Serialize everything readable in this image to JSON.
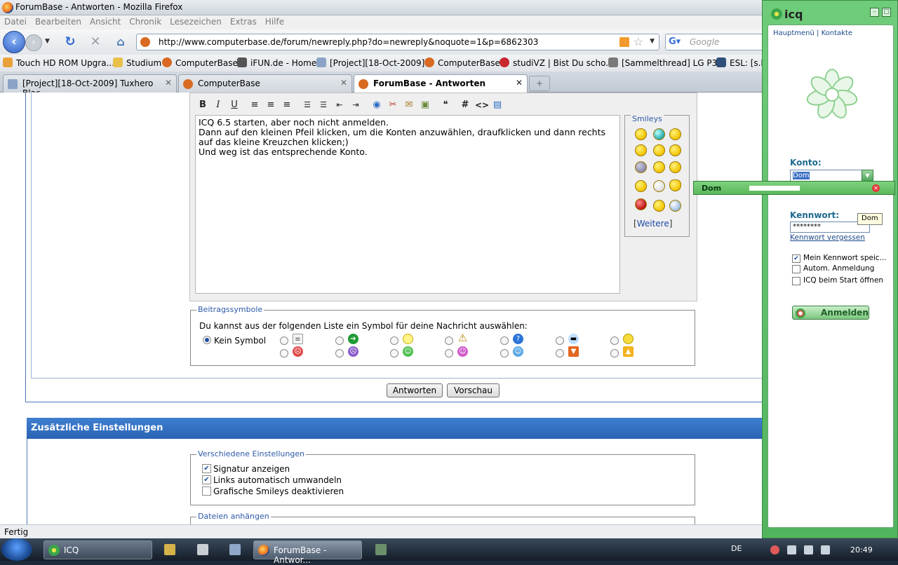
{
  "firefox": {
    "window_title": "ForumBase - Antworten - Mozilla Firefox",
    "menu": [
      "Datei",
      "Bearbeiten",
      "Ansicht",
      "Chronik",
      "Lesezeichen",
      "Extras",
      "Hilfe"
    ],
    "url": "http://www.computerbase.de/forum/newreply.php?do=newreply&noquote=1&p=6862303",
    "search_placeholder": "Google",
    "bookmarks": [
      "Touch HD ROM Upgra...",
      "Studium",
      "ComputerBase",
      "iFUN.de - Home",
      "[Project][18-Oct-2009]...",
      "ComputerBase",
      "studiVZ | Bist Du scho...",
      "[Sammelthread] LG P3...",
      "ESL: [s.k"
    ],
    "tabs": [
      {
        "label": "[Project][18-Oct-2009] Tuxhero Blac...",
        "active": false
      },
      {
        "label": "ComputerBase",
        "active": false
      },
      {
        "label": "ForumBase - Antworten",
        "active": true
      }
    ],
    "status": "Fertig"
  },
  "editor": {
    "lines": [
      "ICQ 6.5 starten, aber noch nicht anmelden.",
      "Dann auf den kleinen Pfeil klicken, um die Konten anzuwählen, draufklicken und dann rechts",
      "auf das kleine Kreuzchen klicken;)",
      "Und weg ist das entsprechende Konto."
    ],
    "toolbar": {
      "bold": "B",
      "italic": "I",
      "underline": "U",
      "code": "#",
      "html": "<>"
    },
    "smileys_title": "Smileys",
    "more_smileys": "Weitere"
  },
  "post_icons": {
    "title": "Beitragssymbole",
    "description": "Du kannst aus der folgenden Liste ein Symbol für deine Nachricht auswählen:",
    "none_label": "Kein Symbol",
    "selected": "Kein Symbol"
  },
  "buttons": {
    "reply": "Antworten",
    "preview": "Vorschau"
  },
  "additional": {
    "title": "Zusätzliche Einstellungen",
    "misc_title": "Verschiedene Einstellungen",
    "options": [
      {
        "label": "Signatur anzeigen",
        "checked": true
      },
      {
        "label": "Links automatisch umwandeln",
        "checked": true
      },
      {
        "label": "Grafische Smileys deaktivieren",
        "checked": false
      }
    ],
    "attach_title": "Dateien anhängen"
  },
  "icq": {
    "logo": "icq",
    "nav_main": "Hauptmenü",
    "nav_sep": "|",
    "nav_contacts": "Kontakte",
    "account_label": "Konto:",
    "account_value": "Dom",
    "dropdown_item": "Dom",
    "tooltip": "Dom",
    "password_label": "Kennwort:",
    "password_value": "********",
    "forgot_password": "Kennwort vergessen",
    "options": [
      {
        "label": "Mein Kennwort speic...",
        "checked": true
      },
      {
        "label": "Autom. Anmeldung",
        "checked": false
      },
      {
        "label": "ICQ beim Start öffnen",
        "checked": false
      }
    ],
    "login_button": "Anmelden"
  },
  "taskbar": {
    "tasks": [
      {
        "label": "ICQ"
      },
      {
        "label": "ForumBase - Antwor..."
      }
    ],
    "language": "DE",
    "clock": "20:49"
  }
}
